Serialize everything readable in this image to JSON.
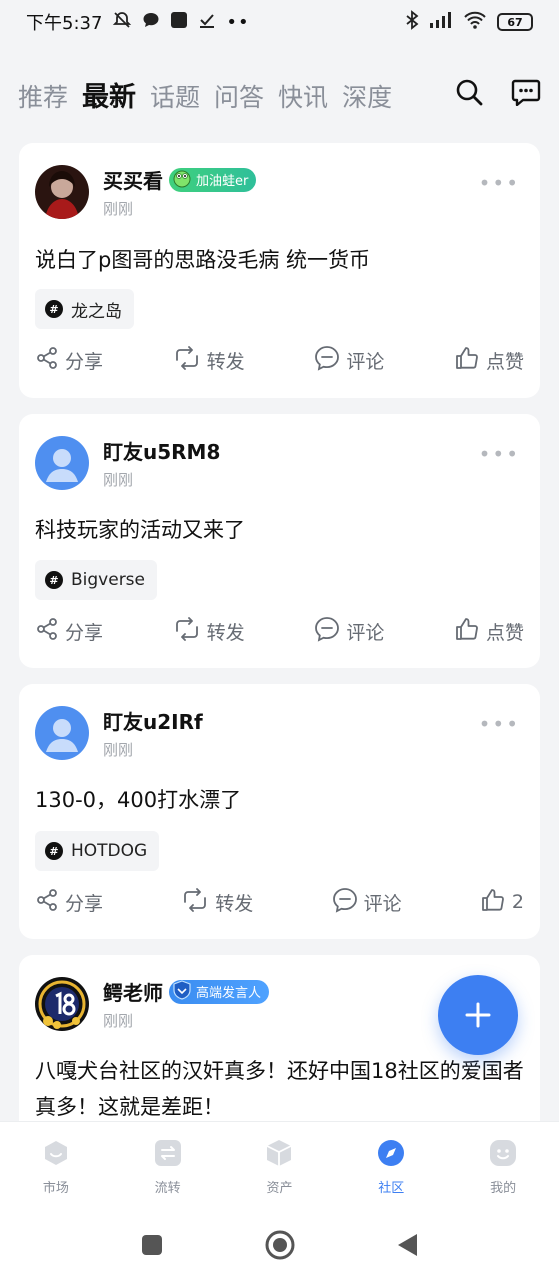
{
  "status": {
    "time": "下午5:37",
    "battery": "67"
  },
  "nav": {
    "tabs": [
      "推荐",
      "最新",
      "话题",
      "问答",
      "快讯",
      "深度"
    ],
    "active_tab": "最新"
  },
  "posts": [
    {
      "author": "买买看",
      "badge": "加油蛙er",
      "time": "刚刚",
      "text": "说白了p图哥的思路没毛病 统一货币",
      "tag": "龙之岛",
      "actions": {
        "share": "分享",
        "repost": "转发",
        "comment": "评论",
        "like": "点赞"
      }
    },
    {
      "author": "盯友u5RM8",
      "time": "刚刚",
      "text": "科技玩家的活动又来了",
      "tag": "Bigverse",
      "actions": {
        "share": "分享",
        "repost": "转发",
        "comment": "评论",
        "like": "点赞"
      }
    },
    {
      "author": "盯友u2IRf",
      "time": "刚刚",
      "text": "130-0，400打水漂了",
      "tag": "HOTDOG",
      "actions": {
        "share": "分享",
        "repost": "转发",
        "comment": "评论",
        "like": "2"
      }
    },
    {
      "author": "鳄老师",
      "badge": "高端发言人",
      "time": "刚刚",
      "text": "八嘎犬台社区的汉奸真多！还好中国18社区的爱国者真多！这就是差距！"
    }
  ],
  "tabbar": {
    "items": [
      "市场",
      "流转",
      "资产",
      "社区",
      "我的"
    ],
    "active": "社区"
  },
  "colors": {
    "accent": "#3d7ff2",
    "badge_green": "#3fd07d",
    "badge_blue": "#3a8cf0"
  }
}
